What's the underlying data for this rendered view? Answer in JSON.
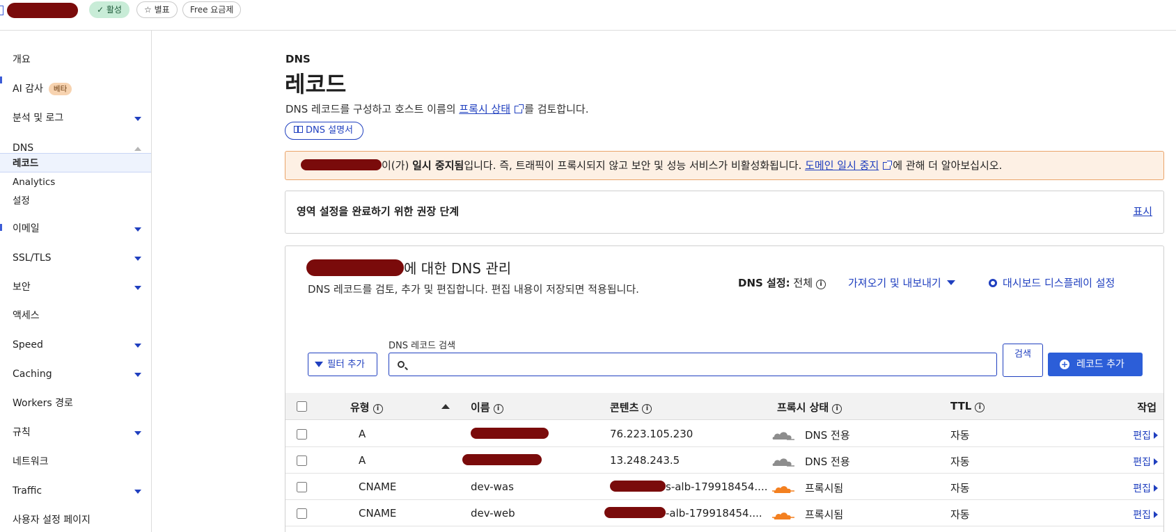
{
  "topbar": {
    "status_label": "✓ 활성",
    "star_label": "☆ 별표",
    "plan_label": "Free 요금제"
  },
  "sidebar": {
    "items": [
      {
        "label": "개요"
      },
      {
        "label": "AI 감사",
        "badge": "베타"
      },
      {
        "label": "분석 및 로그"
      },
      {
        "label": "DNS"
      },
      {
        "label": "레코드"
      },
      {
        "label": "Analytics"
      },
      {
        "label": "설정"
      },
      {
        "label": "이메일"
      },
      {
        "label": "SSL/TLS"
      },
      {
        "label": "보안"
      },
      {
        "label": "액세스"
      },
      {
        "label": "Speed"
      },
      {
        "label": "Caching"
      },
      {
        "label": "Workers 경로"
      },
      {
        "label": "규칙"
      },
      {
        "label": "네트워크"
      },
      {
        "label": "Traffic"
      },
      {
        "label": "사용자 설정 페이지"
      }
    ]
  },
  "main": {
    "section_label": "DNS",
    "title": "레코드",
    "description_prefix": "DNS 레코드를 구성하고 호스트 이름의 ",
    "description_link": "프록시 상태",
    "description_suffix": "를 검토합니다.",
    "doc_button": "DNS 설명서",
    "alert": {
      "prefix": "이(가) ",
      "bold": "일시 중지됨",
      "middle": "입니다. 즉, 트래픽이 프록시되지 않고 보안 및 성능 서비스가 비활성화됩니다. ",
      "link": "도메인 일시 중지",
      "suffix": "에 관해 더 알아보십시오."
    },
    "steps_card": {
      "title": "영역 설정을 완료하기 위한 권장 단계",
      "show_link": "표시"
    },
    "manage": {
      "heading_suffix": "에 대한 DNS 관리",
      "description": "DNS 레코드를 검토, 추가 및 편집합니다. 편집 내용이 저장되면 적용됩니다.",
      "dns_setting_label": "DNS 설정:",
      "dns_setting_value": "전체",
      "import_export": "가져오기 및 내보내기",
      "dashboard_settings": "대시보드 디스플레이 설정",
      "filter_button": "필터 추가",
      "search_label": "DNS 레코드 검색",
      "search_value": "",
      "search_button": "검색",
      "add_record_button": "레코드 추가",
      "columns": {
        "type": "유형",
        "name": "이름",
        "content": "콘텐츠",
        "proxy": "프록시 상태",
        "ttl": "TTL",
        "action": "작업"
      },
      "rows": [
        {
          "type": "A",
          "name": "",
          "content": "76.223.105.230",
          "proxy": "DNS 전용",
          "ttl": "자동",
          "action": "편집"
        },
        {
          "type": "A",
          "name": "",
          "content": "13.248.243.5",
          "proxy": "DNS 전용",
          "ttl": "자동",
          "action": "편집"
        },
        {
          "type": "CNAME",
          "name": "dev-was",
          "content": "s-alb-179918454....",
          "proxy": "프록시됨",
          "ttl": "자동",
          "action": "편집"
        },
        {
          "type": "CNAME",
          "name": "dev-web",
          "content": "-alb-179918454....",
          "proxy": "프록시됨",
          "ttl": "자동",
          "action": "편집"
        }
      ]
    }
  },
  "colors": {
    "accent": "#1f3fbf",
    "primary_button": "#2c5ed8",
    "alert_bg": "#fdf0e4",
    "alert_border": "#eaa46a",
    "active_pill": "#c8ecd7",
    "cloud_proxied": "#f38020",
    "cloud_dns_only": "#8d8d8d"
  }
}
